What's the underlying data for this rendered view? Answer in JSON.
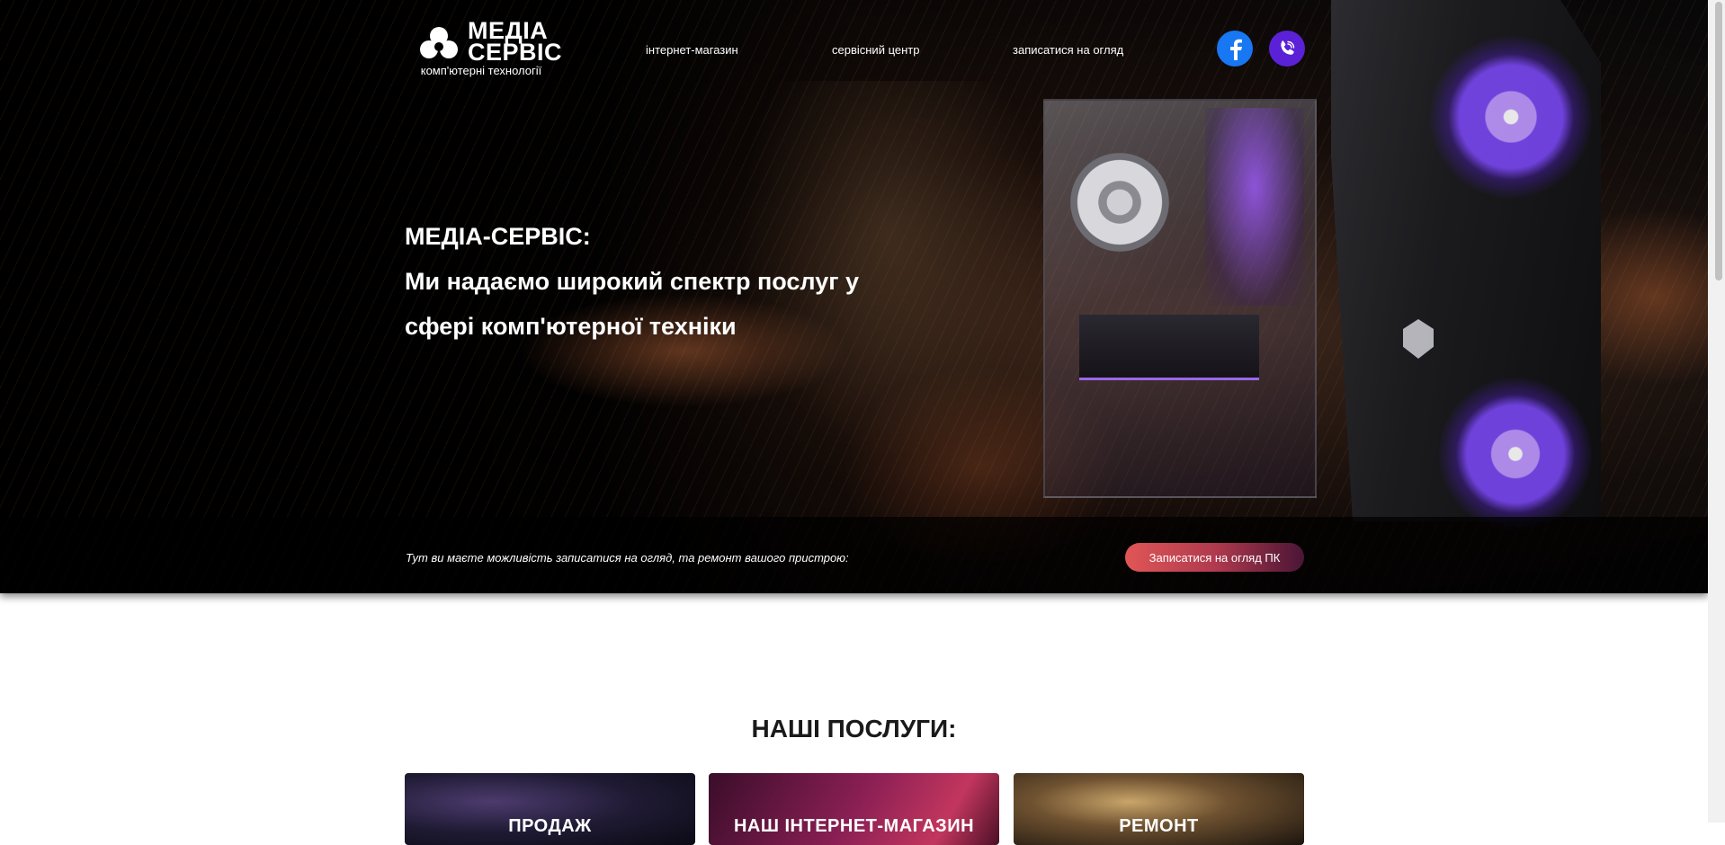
{
  "brand": {
    "name": "МЕДІА\nСЕРВІС",
    "tagline": "комп'ютерні технології"
  },
  "nav": {
    "shop": "інтернет-магазин",
    "service_center": "сервісний центр",
    "signup": "записатися на огляд"
  },
  "social": {
    "facebook_icon": "facebook-icon",
    "phone_icon": "viber-phone-icon",
    "facebook_color": "#1877f2",
    "phone_color": "#5b21d6"
  },
  "hero": {
    "line1": "МЕДІА-СЕРВІС:",
    "line2": "Ми надаємо широкий спектр послуг у",
    "line3": "сфері комп'ютерної техніки"
  },
  "strip": {
    "text": "Тут ви маєте можливість записатися на огляд, та ремонт вашого пристрою:",
    "cta_label": "Записатися на огляд ПК"
  },
  "services": {
    "title": "НАШІ ПОСЛУГИ:",
    "cards": [
      {
        "label": "ПРОДАЖ"
      },
      {
        "label": "НАШ ІНТЕРНЕТ-МАГАЗИН"
      },
      {
        "label": "РЕМОНТ"
      }
    ]
  }
}
